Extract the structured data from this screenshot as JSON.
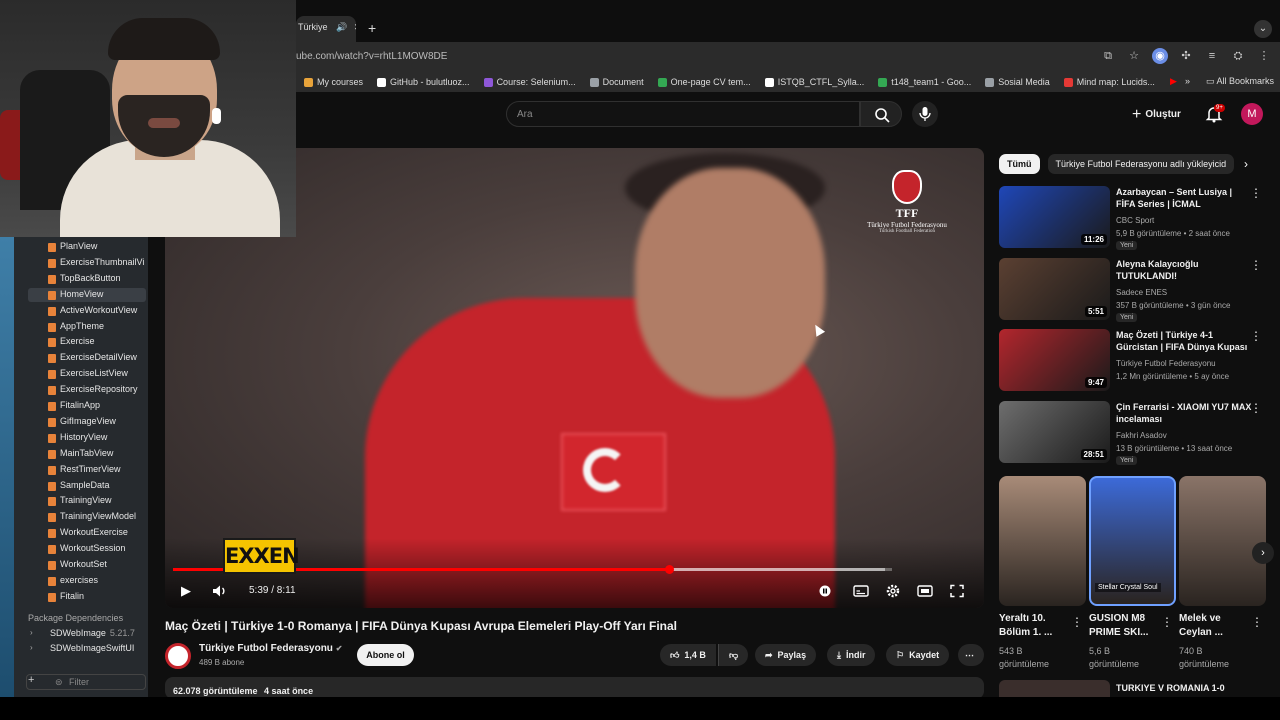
{
  "browser": {
    "tab_label": "Türkiye",
    "url": "ube.com/watch?v=rhtL1MOW8DE",
    "bookmarks": [
      {
        "label": "My courses",
        "color": "#e8a33a"
      },
      {
        "label": "GitHub - bulutluoz...",
        "color": "#ffffff"
      },
      {
        "label": "Course: Selenium...",
        "color": "#8e57d8"
      },
      {
        "label": "Document",
        "color": "#9aa0a6"
      },
      {
        "label": "One-page CV tem...",
        "color": "#34a853"
      },
      {
        "label": "ISTQB_CTFL_Sylla...",
        "color": "#ffffff"
      },
      {
        "label": "t148_team1 - Goo...",
        "color": "#34a853"
      },
      {
        "label": "Sosial Media",
        "color": "#9aa0a6"
      },
      {
        "label": "Mind map: Lucids...",
        "color": "#e53935"
      }
    ],
    "all_bookmarks": "All Bookmarks"
  },
  "xcode": {
    "files": [
      "PlanView",
      "ExerciseThumbnailVi",
      "TopBackButton",
      "HomeView",
      "ActiveWorkoutView",
      "AppTheme",
      "Exercise",
      "ExerciseDetailView",
      "ExerciseListView",
      "ExerciseRepository",
      "FitalinApp",
      "GifImageView",
      "HistoryView",
      "MainTabView",
      "RestTimerView",
      "SampleData",
      "TrainingView",
      "TrainingViewModel",
      "WorkoutExercise",
      "WorkoutSession",
      "WorkoutSet",
      "exercises",
      "Fitalin"
    ],
    "selected": "HomeView",
    "section": "Package Dependencies",
    "packages": [
      {
        "name": "SDWebImage",
        "version": "5.21.7"
      },
      {
        "name": "SDWebImageSwiftUI",
        "version": ""
      }
    ],
    "filter_placeholder": "Filter"
  },
  "youtube": {
    "search_placeholder": "Ara",
    "create_label": "Oluştur",
    "notifications_badge": "9+",
    "avatar_letter": "M",
    "video": {
      "watermark_short": "TFF",
      "watermark_name": "Türkiye Futbol Federasyonu",
      "watermark_sub": "Turkish Football Federation",
      "overlay_brand": "EXXEN",
      "time": "5:39 / 8:11",
      "progress": 0.69,
      "buffered": 0.99,
      "title": "Maç Özeti | Türkiye 1-0 Romanya | FIFA Dünya Kupası Avrupa Elemeleri Play-Off Yarı Final"
    },
    "channel": {
      "name": "Türkiye Futbol Federasyonu",
      "subs": "489 B abone",
      "subscribe": "Abone ol"
    },
    "actions": {
      "likes": "1,4 B",
      "share": "Paylaş",
      "download": "İndir",
      "save": "Kaydet"
    },
    "description": {
      "views": "62.078 görüntüleme",
      "age": "4 saat önce"
    },
    "chips": [
      "Tümü",
      "Türkiye Futbol Federasyonu adlı yükleyicid"
    ],
    "recommendations": [
      {
        "title": "Azarbaycan – Sent Lusiya | FİFA Series | İCMAL",
        "channel": "CBC Sport",
        "meta": "5,9 B görüntüleme • 2 saat önce",
        "duration": "11:26",
        "badge": "Yeni",
        "thumb_color": "#1f47b8"
      },
      {
        "title": "Aleyna Kalaycıoğlu TUTUKLANDI!",
        "channel": "Sadece ENES",
        "meta": "357 B görüntüleme • 3 gün önce",
        "duration": "5:51",
        "badge": "Yeni",
        "thumb_color": "#5b4032"
      },
      {
        "title": "Maç Özeti | Türkiye 4-1 Gürcistan | FIFA Dünya Kupası ...",
        "channel": "Türkiye Futbol Federasyonu",
        "meta": "1,2 Mn görüntüleme • 5 ay önce",
        "duration": "9:47",
        "badge": "",
        "thumb_color": "#b3262d"
      },
      {
        "title": "Çin Ferrarisi - XIAOMI YU7 MAX incelaması",
        "channel": "Fakhri Asadov",
        "meta": "13 B görüntüleme • 13 saat önce",
        "duration": "28:51",
        "badge": "Yeni",
        "thumb_color": "#6e6e6e"
      }
    ],
    "shorts": [
      {
        "title": "Yeraltı 10. Bölüm 1. ...",
        "views": "543 B görüntüleme",
        "thumb_color": "#a88b78"
      },
      {
        "title": "GUSION M8 PRIME SKI...",
        "views": "5,6 B görüntüleme",
        "thumb_color": "#3c6ad8",
        "caption": "Stellar Crystal Soul"
      },
      {
        "title": "Melek ve Ceylan ...",
        "views": "740 B görüntüleme",
        "thumb_color": "#8a7468"
      }
    ],
    "next_rec_title": "TURKIYE V ROMANIA 1-0"
  }
}
